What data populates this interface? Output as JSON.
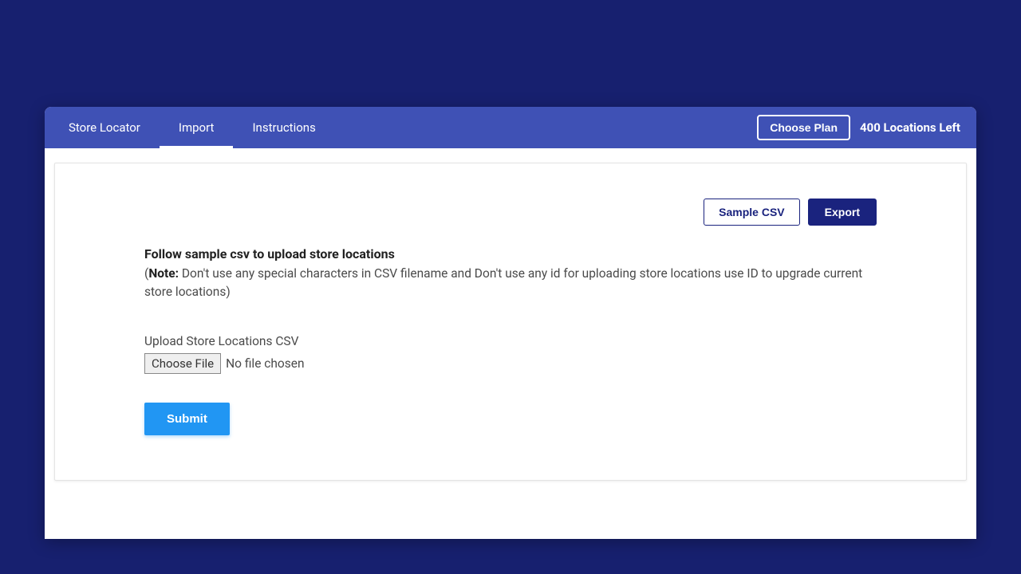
{
  "topbar": {
    "tabs": [
      {
        "label": "Store Locator",
        "active": false
      },
      {
        "label": "Import",
        "active": true
      },
      {
        "label": "Instructions",
        "active": false
      }
    ],
    "choose_plan_label": "Choose Plan",
    "locations_left": "400 Locations Left"
  },
  "card": {
    "sample_csv_label": "Sample CSV",
    "export_label": "Export",
    "instruction_title": "Follow sample csv to upload store locations",
    "note_label": "Note:",
    "note_text": " Don't use any special characters in CSV filename and Don't use any id for uploading store locations use ID to upgrade current store locations)",
    "upload_label": "Upload Store Locations CSV",
    "choose_file_label": "Choose File",
    "file_status": "No file chosen",
    "submit_label": "Submit"
  }
}
